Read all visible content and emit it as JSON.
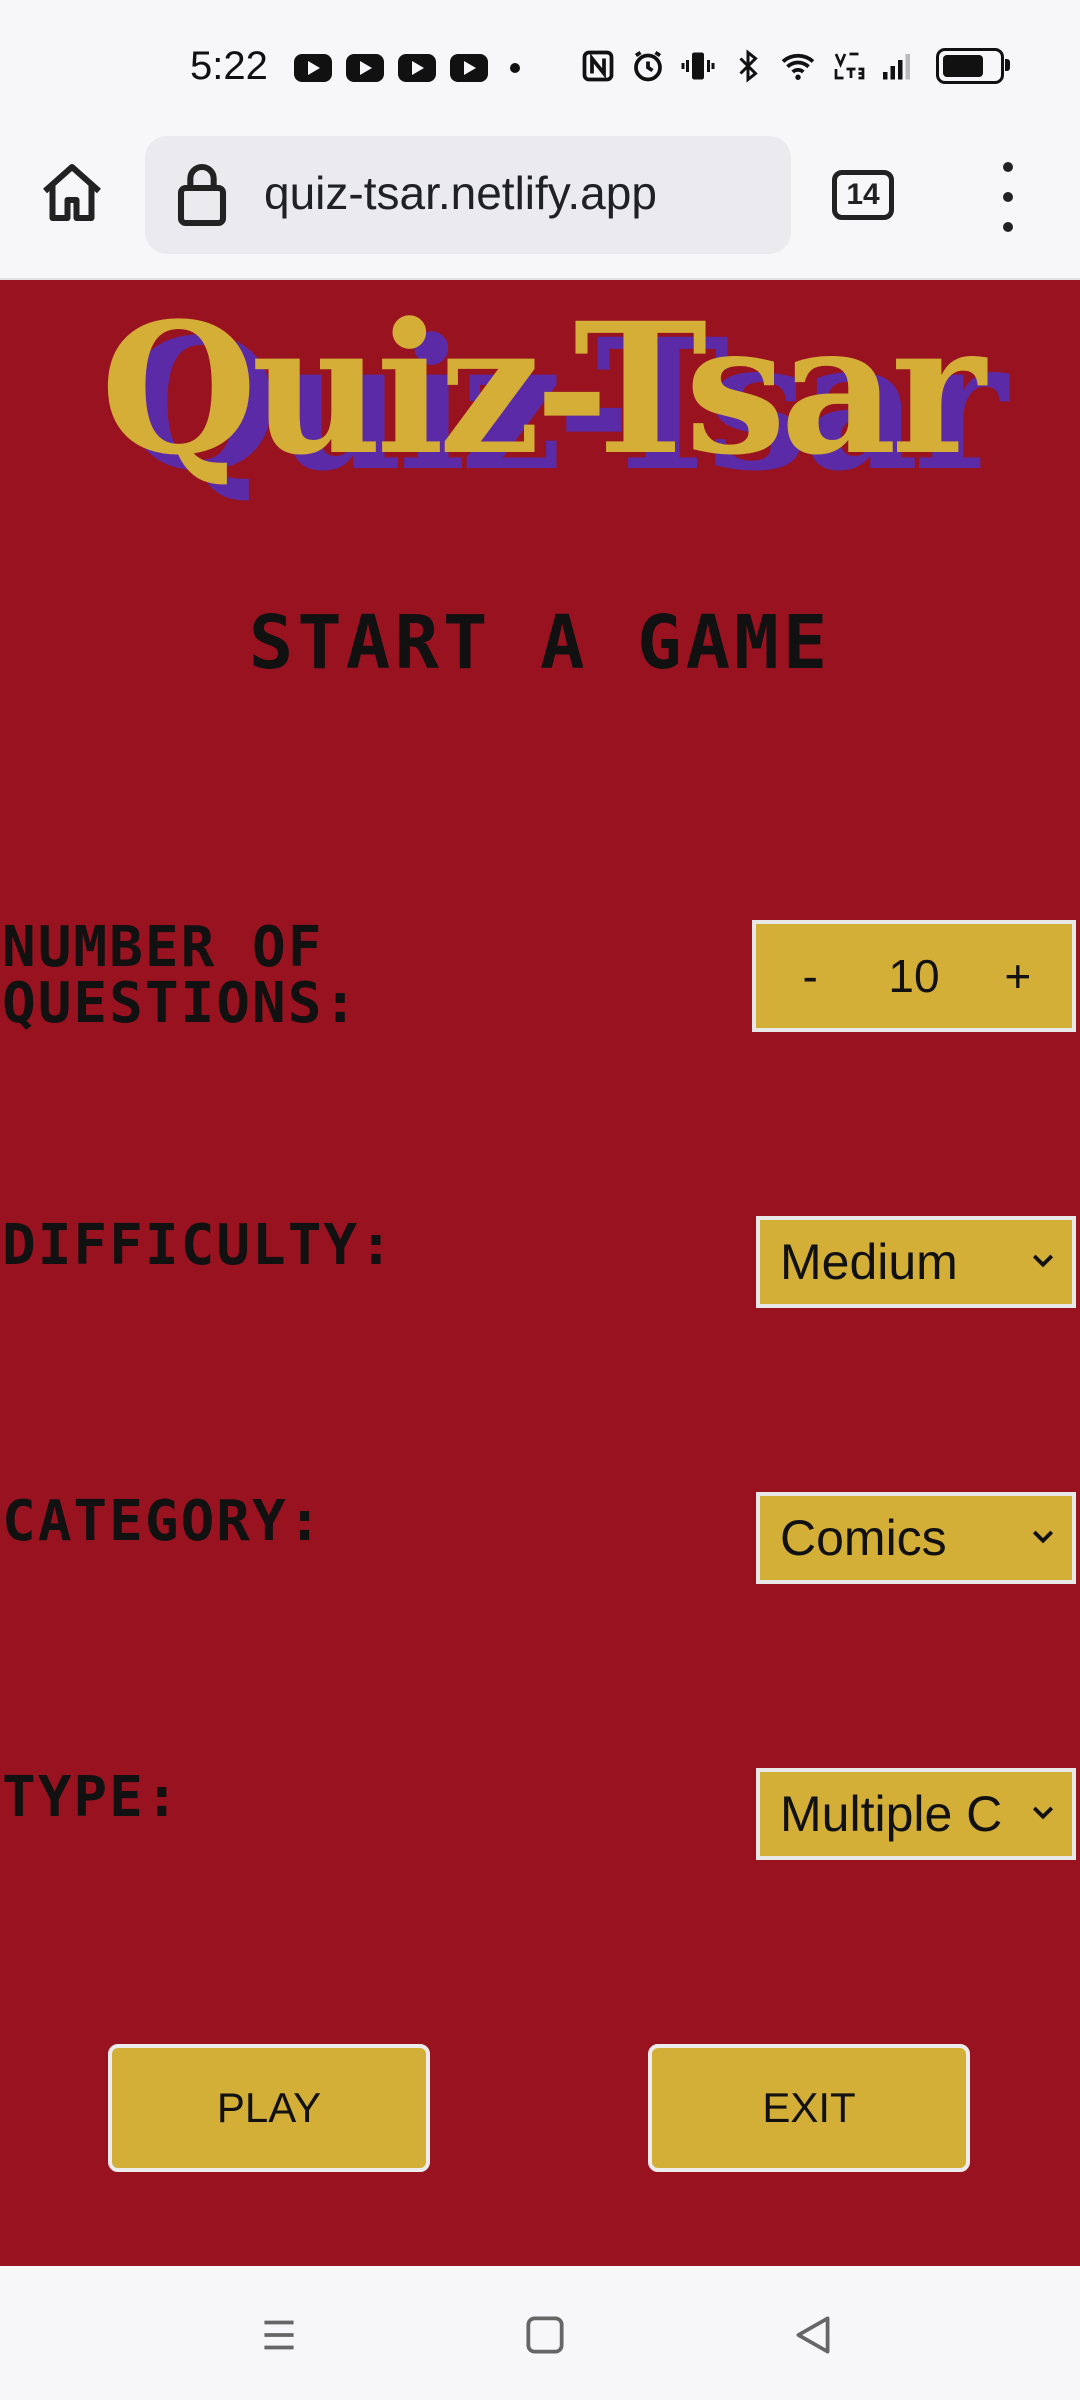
{
  "status_bar": {
    "time": "5:22"
  },
  "browser": {
    "url": "quiz-tsar.netlify.app",
    "tab_count": "14"
  },
  "page": {
    "logo_text": "Quiz-Tsar",
    "heading": "Start a Game",
    "questions": {
      "label_line1": "Number of",
      "label_line2": "Questions:",
      "minus": "-",
      "value": "10",
      "plus": "+"
    },
    "difficulty": {
      "label": "Difficulty:",
      "selected": "Medium"
    },
    "category": {
      "label": "Category:",
      "selected": "Comics"
    },
    "type": {
      "label": "Type:",
      "selected": "Multiple C"
    },
    "play_label": "PLAY",
    "exit_label": "EXIT"
  },
  "colors": {
    "page_bg": "#991220",
    "accent_gold": "#d4af37",
    "logo_shadow": "#5b2aa6"
  }
}
